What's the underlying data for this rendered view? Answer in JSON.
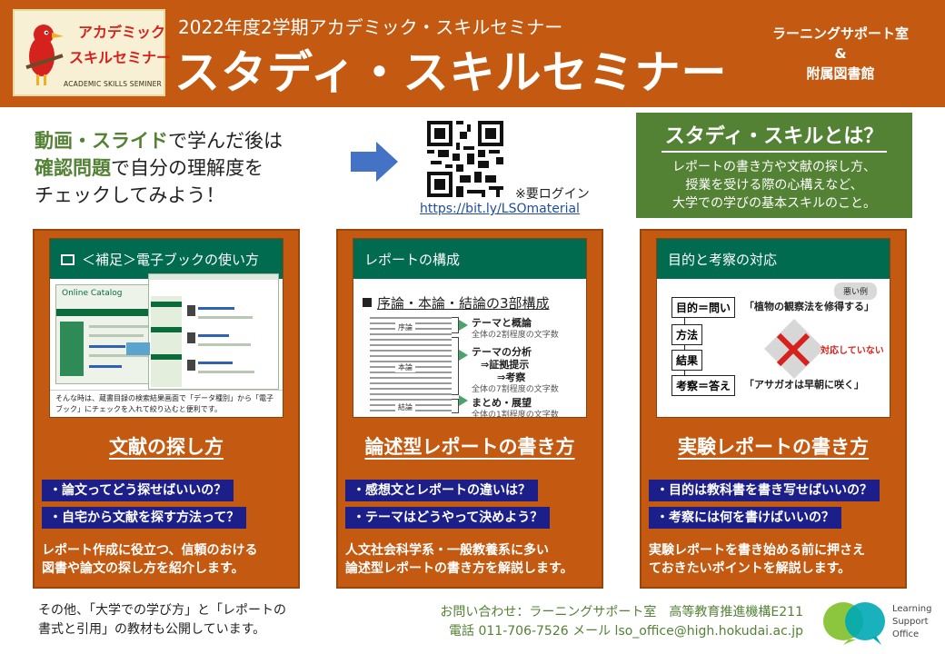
{
  "header": {
    "logo_line1": "アカデミック",
    "logo_line2": "スキルセミナー",
    "logo_line3": "ACADEMIC SKILLS SEMINER",
    "subtitle": "2022年度2学期アカデミック・スキルセミナー",
    "title": "スタディ・スキルセミナー",
    "org1": "ラーニングサポート室",
    "org_amp": "&",
    "org2": "附属図書館"
  },
  "intro": {
    "line1_hl": "動画・スライド",
    "line1_rest": "で学んだ後は",
    "line2_hl": "確認問題",
    "line2_rest": "で自分の理解度を",
    "line3": "チェックしてみよう！",
    "login_note": "※要ログイン",
    "url": "https://bit.ly/LSOmaterial"
  },
  "whatis": {
    "title": "スタディ・スキルとは？",
    "line1": "レポートの書き方や文献の探し方、",
    "line2": "授業を受ける際の心構えなど、",
    "line3": "大学での学びの基本スキルのこと。"
  },
  "cards": [
    {
      "thumb_title": "＜補足＞電子ブックの使い方",
      "thumb_catalog": "Online Catalog",
      "thumb_caption": "そんな時は、蔵書目録の検索結果画面で「データ種別」から「電子ブック」にチェックを入れて絞り込むと便利です。",
      "title": "文献の探し方",
      "q1": "・論文ってどう探せばいいの？",
      "q2": "・自宅から文献を探す方法って？",
      "desc1": "レポート作成に役立つ、信頼のおける",
      "desc2": "図書や論文の探し方を紹介します。"
    },
    {
      "thumb_title": "レポートの構成",
      "thumb_heading": "序論・本論・結論の3部構成",
      "label_intro": "序論",
      "label_body": "本論",
      "label_concl": "結論",
      "s1_title": "テーマと概論",
      "s1_sub": "全体の2割程度の文字数",
      "s2_title": "テーマの分析",
      "s2_a": "⇒証拠提示",
      "s2_b": "⇒考察",
      "s2_sub": "全体の7割程度の文字数",
      "s3_title": "まとめ・展望",
      "s3_sub": "全体の1割程度の文字数",
      "title": "論述型レポートの書き方",
      "q1": "・感想文とレポートの違いは？",
      "q2": "・テーマはどうやって決めよう？",
      "desc1": "人文社会科学系・一般教養系に多い",
      "desc2": "論述型レポートの書き方を解説します。"
    },
    {
      "thumb_title": "目的と考察の対応",
      "badge": "悪い例",
      "box1": "目的＝問い",
      "box2": "方法",
      "box3": "結果",
      "box4": "考察＝答え",
      "quote1": "「植物の観察法を修得する」",
      "quote2": "「アサガオは早朝に咲く」",
      "noresp": "対応していない",
      "title": "実験レポートの書き方",
      "q1": "・目的は教科書を書き写せばいいの？",
      "q2": "・考察には何を書けばいいの？",
      "desc1": "実験レポートを書き始める前に押さえ",
      "desc2": "ておきたいポイントを解説します。"
    }
  ],
  "footer": {
    "left1": "その他、「大学での学び方」と「レポートの",
    "left2": "書式と引用」の教材も公開しています。",
    "contact1": "お問い合わせ：ラーニングサポート室　高等教育推進機構E211",
    "contact2": "電話 011-706-7526 メール lso_office@high.hokudai.ac.jp",
    "lso1": "Learning",
    "lso2": "Support",
    "lso3": "Office"
  },
  "colors": {
    "header_bg": "#c45a11",
    "accent_green": "#548235",
    "question_navy": "#1c1f8a",
    "thumb_header_green": "#006b4f"
  }
}
